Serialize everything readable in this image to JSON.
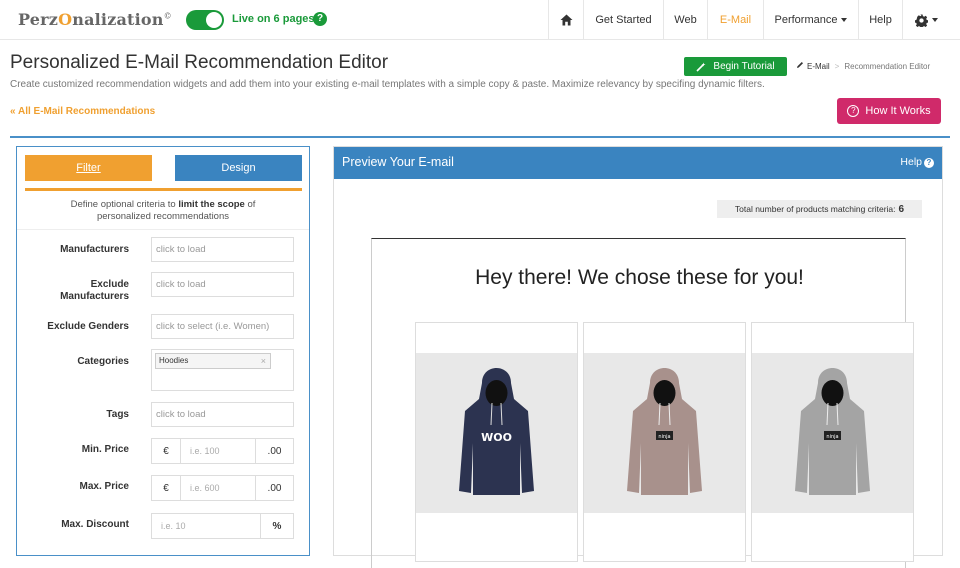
{
  "app": {
    "logo_pre": "Perz",
    "logo_o": "O",
    "logo_post": "nalization",
    "logo_mark": "©",
    "live_status": "Live on 6 pages",
    "help_q": "?"
  },
  "nav": {
    "get_started": "Get Started",
    "web": "Web",
    "email": "E-Mail",
    "performance": "Performance",
    "help": "Help"
  },
  "header": {
    "title": "Personalized E-Mail Recommendation Editor",
    "subtitle": "Create customized recommendation widgets and add them into your existing e-mail templates with a simple copy & paste. Maximize relevancy by specifing dynamic filters.",
    "begin_tutorial": "Begin Tutorial",
    "breadcrumb_1": "E-Mail",
    "breadcrumb_sep": ">",
    "breadcrumb_2": "Recommendation Editor",
    "back_link": "« All E-Mail Recommendations",
    "how_it_works": "How It Works",
    "how_icon": "?"
  },
  "filter": {
    "tab_filter": "Filter",
    "tab_design": "Design",
    "desc_pre": "Define optional criteria to ",
    "desc_bold": "limit the scope",
    "desc_post": " of personalized recommendations",
    "manufacturers_label": "Manufacturers",
    "manufacturers_ph": "click to load",
    "excl_manufacturers_label_1": "Exclude",
    "excl_manufacturers_label_2": "Manufacturers",
    "excl_manufacturers_ph": "click to load",
    "excl_genders_label": "Exclude Genders",
    "excl_genders_ph": "click to select (i.e. Women)",
    "categories_label": "Categories",
    "category_tag": "Hoodies",
    "tag_remove": "×",
    "tags_label": "Tags",
    "tags_ph": "click to load",
    "min_price_label": "Min. Price",
    "min_price_ph": "i.e. 100",
    "max_price_label": "Max. Price",
    "max_price_ph": "i.e. 600",
    "currency": "€",
    "cents": ".00",
    "max_discount_label": "Max. Discount",
    "max_discount_ph": "i.e. 10",
    "percent": "%"
  },
  "preview": {
    "title": "Preview Your E-mail",
    "help": "Help",
    "help_icon": "?",
    "total_label": "Total number of products matching criteria:",
    "total_value": "6",
    "mail_title": "Hey there! We chose these for you!",
    "products": [
      {
        "color": "#2c3350",
        "print": "WOO"
      },
      {
        "color": "#a8918c",
        "print": "ninja"
      },
      {
        "color": "#a4a4a4",
        "print": "ninja"
      }
    ]
  }
}
